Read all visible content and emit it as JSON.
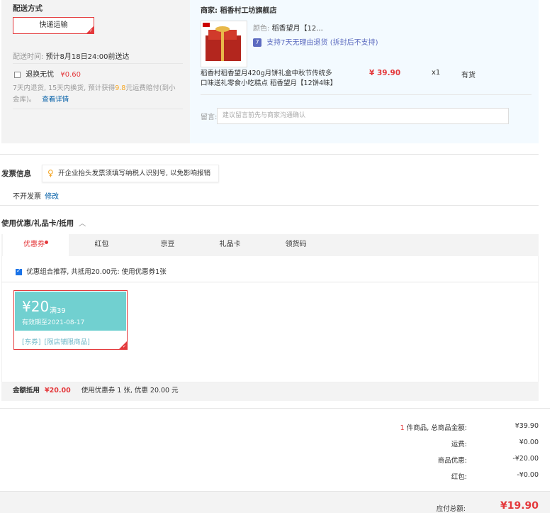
{
  "shipping": {
    "title": "配送方式",
    "method": "快递运输",
    "time_label": "配送时间:",
    "time_value": "预计8月18日24:00前送达",
    "return_label": "退换无忧",
    "return_price": "¥0.60",
    "return_desc_1": "7天内退货, 15天内换货, 预计获得",
    "return_desc_amount": "9.8",
    "return_desc_2": "元运费赔付(到小",
    "return_desc_3": "金库)。",
    "return_link": "查看详情"
  },
  "merchant": {
    "label": "商家:",
    "name": "稻香村工坊旗舰店",
    "product": {
      "color_label": "颜色:",
      "color_value": "稻香望月【12...",
      "return_badge": "7",
      "return_policy": "支持7天无理由退货 (拆封后不支持)",
      "title_line1": "稻香村稻香望月420g月饼礼盒中秋节传统多",
      "title_line2": "口味送礼零食小吃糕点 稻香望月【12饼4味】",
      "price": "¥ 39.90",
      "qty": "x1",
      "stock": "有货"
    },
    "message_label": "留言:",
    "message_placeholder": "建议留言前先与商家沟通确认"
  },
  "invoice": {
    "title": "发票信息",
    "tip": "开企业抬头发票须填写纳税人识别号, 以免影响报销",
    "status": "不开发票",
    "modify": "修改"
  },
  "discount": {
    "title": "使用优惠/礼品卡/抵用",
    "tabs": [
      "优惠券",
      "红包",
      "京豆",
      "礼品卡",
      "领货码"
    ],
    "combo_text": "优惠组合推荐, 共抵用20.00元: 使用优惠券1张",
    "coupon": {
      "amount": "¥20",
      "condition": "满39",
      "validity": "有效期至2021-08-17",
      "tag1": "[东券]",
      "tag2": "[限店铺限商品]"
    },
    "summary_label": "金额抵用",
    "summary_amount": "¥20.00",
    "summary_desc": "使用优惠券 1 张, 优惠 20.00 元"
  },
  "totals": {
    "count": "1",
    "count_label": "件商品, 总商品金额:",
    "goods_total": "¥39.90",
    "freight_label": "运费:",
    "freight": "¥0.00",
    "discount_label": "商品优惠:",
    "discount": "-¥20.00",
    "redpacket_label": "红包:",
    "redpacket": "-¥0.00",
    "payable_label": "应付总额:",
    "payable": "¥19.90"
  },
  "colors": {
    "accent": "#e4393c",
    "link": "#005ea7",
    "coupon": "#71d0d0"
  }
}
